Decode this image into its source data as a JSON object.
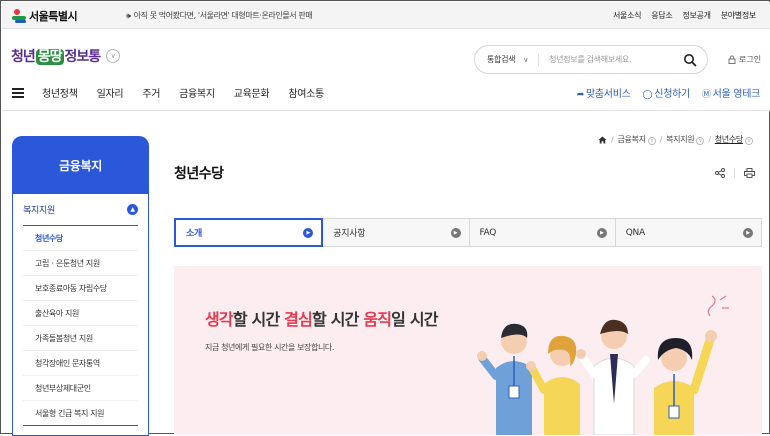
{
  "topbar": {
    "logo_text": "서울특별시",
    "notice": "아직 못 먹어봤다면, '서울라면' 대형마트·온라인몰서 판매",
    "links": [
      "서울소식",
      "응답소",
      "정보공개",
      "분야별정보"
    ]
  },
  "header": {
    "brand": {
      "part1": "청년",
      "part2": "몽땅",
      "part3": "정보통"
    },
    "search": {
      "scope": "통합검색",
      "placeholder": "청년정보를 검색해보세요."
    },
    "login": "로그인"
  },
  "gnb": {
    "menu": [
      "청년정책",
      "일자리",
      "주거",
      "금융복지",
      "교육문화",
      "참여소통"
    ],
    "right": [
      "맞춤서비스",
      "신청하기",
      "서울 영테크"
    ]
  },
  "sidebar": {
    "title": "금융복지",
    "category": "복지지원",
    "items": [
      "청년수당",
      "고립ㆍ은둔청년 지원",
      "보호종료아동 자립수당",
      "출산육아 지원",
      "가족돌봄청년 지원",
      "청각장애인 문자통역",
      "청년부상제대군인",
      "서울형 긴급 복지 지원"
    ]
  },
  "breadcrumb": {
    "items": [
      "금융복지",
      "복지지원",
      "청년수당"
    ]
  },
  "page": {
    "title": "청년수당"
  },
  "tabs": [
    "소개",
    "공지사항",
    "FAQ",
    "QNA"
  ],
  "hero": {
    "w1": "생각",
    "t1": "할 시간  ",
    "w2": "결심",
    "t2": "할 시간  ",
    "w3": "움직",
    "t3": "일 시간",
    "sub": "지금 청년에게 필요한 시간을 보장합니다."
  },
  "colors": {
    "accent": "#2a58d9",
    "highlight": "#e23c52",
    "hero_bg": "#fceef0"
  }
}
